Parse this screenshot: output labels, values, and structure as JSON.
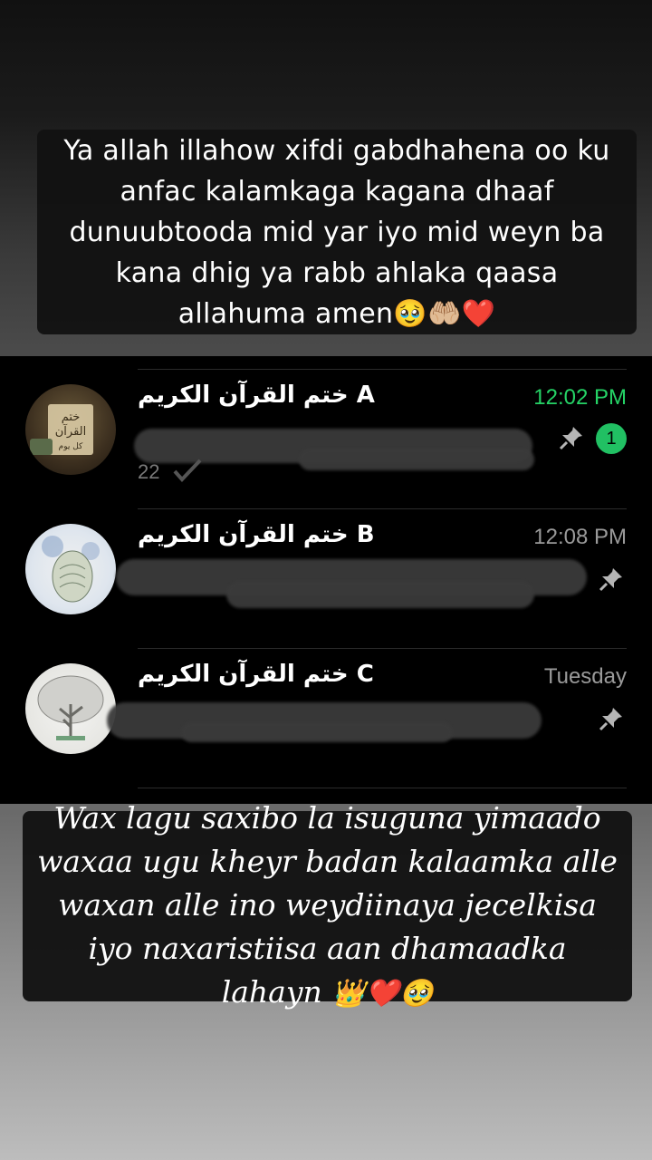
{
  "captions": {
    "top": "Ya allah illahow xifdi gabdhahena oo ku anfac kalamkaga kagana dhaaf dunuubtooda mid yar iyo mid weyn ba kana dhig ya rabb ahlaka qaasa allahuma amen",
    "top_emoji": "🥹🤲🏼❤️",
    "bottom": "Wax lagu saxibo la isuguna yimaado waxaa ugu kheyr badan kalaamka alle waxan alle ino weydiinaya jecelkisa iyo naxaristiisa aan dhamaadka lahayn",
    "bottom_emoji": "👑❤️🥹"
  },
  "chats": [
    {
      "name": "ختم القرآن الكريم A",
      "time": "12:02 PM",
      "time_color": "#25d366",
      "unread_count": "1",
      "pinned": true,
      "preview_suffix": "22",
      "avatar_text_line1": "ختم",
      "avatar_text_line2": "القرآن",
      "avatar_text_line3": "كل يوم"
    },
    {
      "name": "ختم القرآن الكريم B",
      "time": "12:08 PM",
      "pinned": true
    },
    {
      "name": "ختم القرآن الكريم C",
      "time": "Tuesday",
      "pinned": true
    }
  ],
  "colors": {
    "panel_bg": "#000000",
    "unread_green": "#21c063",
    "caption_bg": "#121212"
  }
}
